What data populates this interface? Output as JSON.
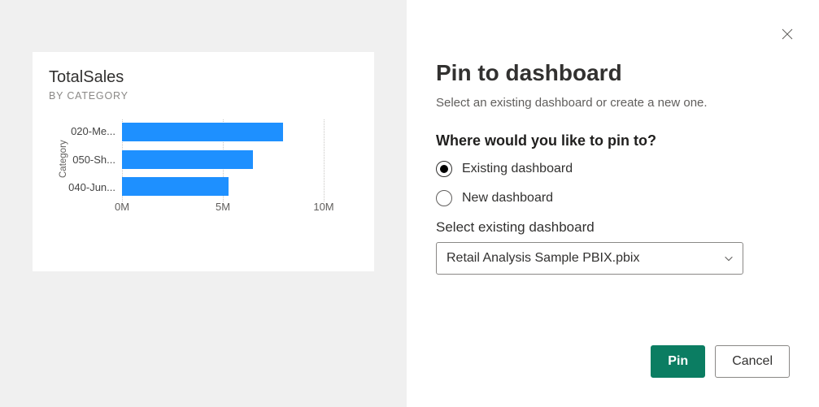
{
  "chart_data": {
    "type": "bar",
    "orientation": "horizontal",
    "title": "TotalSales",
    "subtitle": "BY CATEGORY",
    "y_axis_title": "Category",
    "categories": [
      "020-Me...",
      "050-Sh...",
      "040-Jun..."
    ],
    "values": [
      8.0,
      6.5,
      5.3
    ],
    "xlabel": "",
    "xlim": [
      0,
      10
    ],
    "x_ticks": [
      "0M",
      "5M",
      "10M"
    ],
    "unit": "M"
  },
  "dialog": {
    "title": "Pin to dashboard",
    "description": "Select an existing dashboard or create a new one.",
    "question": "Where would you like to pin to?",
    "options": {
      "existing": "Existing dashboard",
      "new": "New dashboard"
    },
    "selected_option": "existing",
    "select_label": "Select existing dashboard",
    "selected_dashboard": "Retail Analysis Sample PBIX.pbix",
    "buttons": {
      "pin": "Pin",
      "cancel": "Cancel"
    },
    "close_icon": "close-icon",
    "chevron_icon": "chevron-down-icon"
  },
  "colors": {
    "bar": "#1e90ff",
    "primary_button": "#0b7d62"
  }
}
